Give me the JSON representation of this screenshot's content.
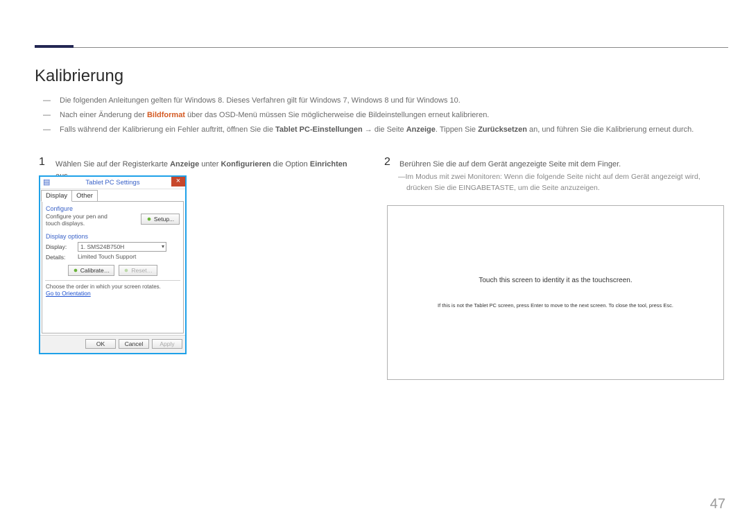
{
  "topbar": {},
  "heading": "Kalibrierung",
  "notes": {
    "n1_full": "Die folgenden Anleitungen gelten für Windows 8. Dieses Verfahren gilt für Windows 7, Windows 8 und für Windows 10.",
    "n2_pre": "Nach einer Änderung der ",
    "n2_hi": "Bildformat",
    "n2_post": " über das OSD-Menü müssen Sie möglicherweise die Bildeinstellungen erneut kalibrieren.",
    "n3_pre": "Falls während der Kalibrierung ein Fehler auftritt, öffnen Sie die ",
    "n3_b1": "Tablet PC-Einstellungen ",
    "n3_arrow": "→",
    "n3_mid1": " die Seite ",
    "n3_b2": "Anzeige",
    "n3_mid2": ". Tippen Sie ",
    "n3_b3": "Zurücksetzen",
    "n3_post": " an, und führen Sie die Kalibrierung erneut durch."
  },
  "steps": {
    "s1_num": "1",
    "s1_pre": "Wählen Sie auf der Registerkarte ",
    "s1_b1": "Anzeige",
    "s1_mid1": " unter ",
    "s1_b2": "Konfigurieren",
    "s1_mid2": " die Option ",
    "s1_b3": "Einrichten",
    "s1_post": " aus.",
    "s2_num": "2",
    "s2_text": "Berühren Sie die auf dem Gerät angezeigte Seite mit dem Finger.",
    "s2_sub": "Im Modus mit zwei Monitoren: Wenn die folgende Seite nicht auf dem Gerät angezeigt wird, drücken Sie die EINGABETASTE, um die Seite anzuzeigen."
  },
  "dialog": {
    "title": "Tablet PC Settings",
    "tabs": {
      "display": "Display",
      "other": "Other"
    },
    "configure_label": "Configure",
    "configure_text": "Configure your pen and touch displays.",
    "setup_btn": "Setup...",
    "display_options_label": "Display options",
    "display_row_label": "Display:",
    "display_value": "1. SMS24B750H",
    "details_row_label": "Details:",
    "details_value": "Limited Touch Support",
    "calibrate_btn": "Calibrate…",
    "reset_btn": "Reset…",
    "order_text": "Choose the order in which your screen rotates.",
    "orientation_link": "Go to Orientation",
    "ok": "OK",
    "cancel": "Cancel",
    "apply": "Apply"
  },
  "touch_panel": {
    "main": "Touch this screen to identity it as the touchscreen.",
    "sub": "If this is not the Tablet PC screen, press Enter to move to the next screen. To close the tool, press Esc."
  },
  "page_number": "47"
}
